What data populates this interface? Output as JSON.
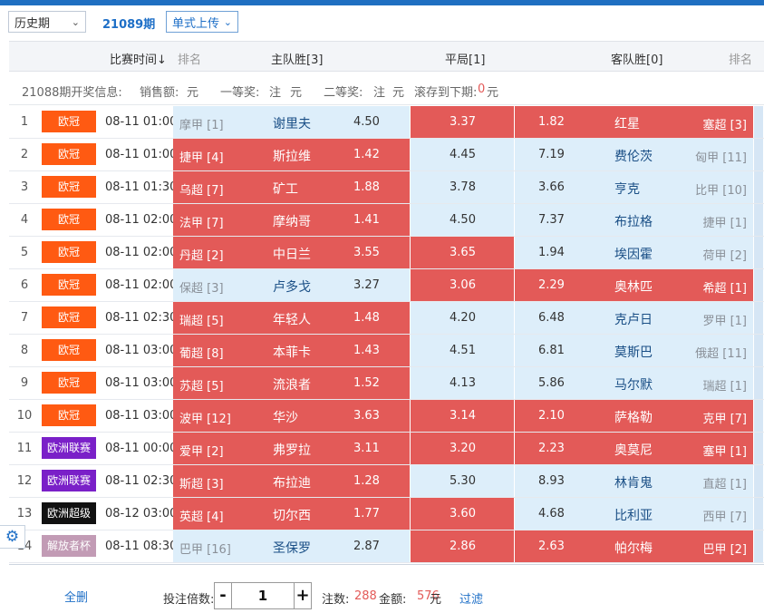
{
  "controls": {
    "history_select": "历史期",
    "period": "21089期",
    "upload_select": "单式上传"
  },
  "header": {
    "time": "比赛时间↓",
    "rank": "排名",
    "home": "主队胜[3]",
    "draw": "平局[1]",
    "away": "客队胜[0]",
    "rank2": "排名"
  },
  "info": {
    "label": "21088期开奖信息:",
    "sales_label": "销售额:",
    "sales_unit": "元",
    "first_label": "一等奖:",
    "first_value": "注",
    "first_unit": "元",
    "second_label": "二等奖:",
    "second_value": "注",
    "second_unit": "元",
    "rollover_label": "滚存到下期:",
    "rollover_value": "0",
    "rollover_unit": "元"
  },
  "colors": {
    "red": "#e35a58",
    "blue_cell": "#ddeefa",
    "league_orange": "#ff5a12",
    "league_purple": "#7a20c8",
    "league_black": "#111111",
    "league_mauve": "#c29bb5",
    "accent": "#1e6fc7"
  },
  "matches": [
    {
      "no": "1",
      "league": "欧冠",
      "league_color": "#ff5a12",
      "time": "08-11 01:00",
      "home_rank": "摩甲 [1]",
      "home": "谢里夫",
      "home_odds": "4.50",
      "draw_odds": "3.37",
      "away_odds": "1.82",
      "away": "红星",
      "away_rank": "塞超 [3]",
      "home_sel": false,
      "draw_sel": true,
      "away_sel": true
    },
    {
      "no": "2",
      "league": "欧冠",
      "league_color": "#ff5a12",
      "time": "08-11 01:00",
      "home_rank": "捷甲 [4]",
      "home": "斯拉维",
      "home_odds": "1.42",
      "draw_odds": "4.45",
      "away_odds": "7.19",
      "away": "费伦茨",
      "away_rank": "匈甲 [11]",
      "home_sel": true,
      "draw_sel": false,
      "away_sel": false
    },
    {
      "no": "3",
      "league": "欧冠",
      "league_color": "#ff5a12",
      "time": "08-11 01:30",
      "home_rank": "乌超 [7]",
      "home": "矿工",
      "home_odds": "1.88",
      "draw_odds": "3.78",
      "away_odds": "3.66",
      "away": "亨克",
      "away_rank": "比甲 [10]",
      "home_sel": true,
      "draw_sel": false,
      "away_sel": false
    },
    {
      "no": "4",
      "league": "欧冠",
      "league_color": "#ff5a12",
      "time": "08-11 02:00",
      "home_rank": "法甲 [7]",
      "home": "摩纳哥",
      "home_odds": "1.41",
      "draw_odds": "4.50",
      "away_odds": "7.37",
      "away": "布拉格",
      "away_rank": "捷甲 [1]",
      "home_sel": true,
      "draw_sel": false,
      "away_sel": false
    },
    {
      "no": "5",
      "league": "欧冠",
      "league_color": "#ff5a12",
      "time": "08-11 02:00",
      "home_rank": "丹超 [2]",
      "home": "中日兰",
      "home_odds": "3.55",
      "draw_odds": "3.65",
      "away_odds": "1.94",
      "away": "埃因霍",
      "away_rank": "荷甲 [2]",
      "home_sel": true,
      "draw_sel": true,
      "away_sel": false
    },
    {
      "no": "6",
      "league": "欧冠",
      "league_color": "#ff5a12",
      "time": "08-11 02:00",
      "home_rank": "保超 [3]",
      "home": "卢多戈",
      "home_odds": "3.27",
      "draw_odds": "3.06",
      "away_odds": "2.29",
      "away": "奥林匹",
      "away_rank": "希超 [1]",
      "home_sel": false,
      "draw_sel": true,
      "away_sel": true
    },
    {
      "no": "7",
      "league": "欧冠",
      "league_color": "#ff5a12",
      "time": "08-11 02:30",
      "home_rank": "瑞超 [5]",
      "home": "年轻人",
      "home_odds": "1.48",
      "draw_odds": "4.20",
      "away_odds": "6.48",
      "away": "克卢日",
      "away_rank": "罗甲 [1]",
      "home_sel": true,
      "draw_sel": false,
      "away_sel": false
    },
    {
      "no": "8",
      "league": "欧冠",
      "league_color": "#ff5a12",
      "time": "08-11 03:00",
      "home_rank": "葡超 [8]",
      "home": "本菲卡",
      "home_odds": "1.43",
      "draw_odds": "4.51",
      "away_odds": "6.81",
      "away": "莫斯巴",
      "away_rank": "俄超 [11]",
      "home_sel": true,
      "draw_sel": false,
      "away_sel": false
    },
    {
      "no": "9",
      "league": "欧冠",
      "league_color": "#ff5a12",
      "time": "08-11 03:00",
      "home_rank": "苏超 [5]",
      "home": "流浪者",
      "home_odds": "1.52",
      "draw_odds": "4.13",
      "away_odds": "5.86",
      "away": "马尔默",
      "away_rank": "瑞超 [1]",
      "home_sel": true,
      "draw_sel": false,
      "away_sel": false
    },
    {
      "no": "10",
      "league": "欧冠",
      "league_color": "#ff5a12",
      "time": "08-11 03:00",
      "home_rank": "波甲 [12]",
      "home": "华沙",
      "home_odds": "3.63",
      "draw_odds": "3.14",
      "away_odds": "2.10",
      "away": "萨格勒",
      "away_rank": "克甲 [7]",
      "home_sel": true,
      "draw_sel": true,
      "away_sel": true
    },
    {
      "no": "11",
      "league": "欧洲联赛",
      "league_color": "#7a20c8",
      "time": "08-11 00:00",
      "home_rank": "爱甲 [2]",
      "home": "弗罗拉",
      "home_odds": "3.11",
      "draw_odds": "3.20",
      "away_odds": "2.23",
      "away": "奥莫尼",
      "away_rank": "塞甲 [1]",
      "home_sel": true,
      "draw_sel": true,
      "away_sel": true
    },
    {
      "no": "12",
      "league": "欧洲联赛",
      "league_color": "#7a20c8",
      "time": "08-11 02:30",
      "home_rank": "斯超 [3]",
      "home": "布拉迪",
      "home_odds": "1.28",
      "draw_odds": "5.30",
      "away_odds": "8.93",
      "away": "林肯鬼",
      "away_rank": "直超 [1]",
      "home_sel": true,
      "draw_sel": false,
      "away_sel": false
    },
    {
      "no": "13",
      "league": "欧洲超级",
      "league_color": "#111111",
      "time": "08-12 03:00",
      "home_rank": "英超 [4]",
      "home": "切尔西",
      "home_odds": "1.77",
      "draw_odds": "3.60",
      "away_odds": "4.68",
      "away": "比利亚",
      "away_rank": "西甲 [7]",
      "home_sel": true,
      "draw_sel": true,
      "away_sel": false
    },
    {
      "no": "14",
      "league": "解放者杯",
      "league_color": "#c29bb5",
      "time": "08-11 08:30",
      "home_rank": "巴甲 [16]",
      "home": "圣保罗",
      "home_odds": "2.87",
      "draw_odds": "2.86",
      "away_odds": "2.63",
      "away": "帕尔梅",
      "away_rank": "巴甲 [2]",
      "home_sel": false,
      "draw_sel": true,
      "away_sel": true
    }
  ],
  "footer": {
    "clear_label": "全删",
    "multiplier_label": "投注倍数:",
    "minus": "-",
    "multiplier_value": "1",
    "plus": "+",
    "bets_label": "注数:",
    "bets_value": "288",
    "amount_label": "金额:",
    "amount_value": "576",
    "amount_unit": "元",
    "filter_label": "过滤"
  }
}
